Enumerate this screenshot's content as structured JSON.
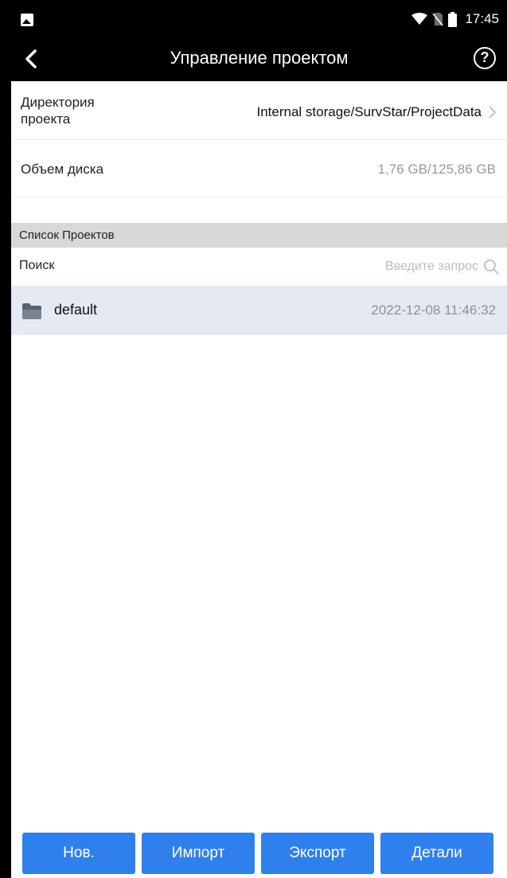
{
  "status_bar": {
    "time": "17:45",
    "icons": [
      "image-icon",
      "wifi-icon",
      "no-sim-icon",
      "battery-icon"
    ]
  },
  "app_bar": {
    "title": "Управление проектом",
    "back_icon": "chevron-left-icon",
    "help_icon": "help-circle-icon",
    "help_glyph": "?"
  },
  "project_directory": {
    "label": "Директория проекта",
    "value": "Internal storage/SurvStar/ProjectData"
  },
  "disk_space": {
    "label": "Объем диска",
    "value": "1,76 GB/125,86 GB"
  },
  "project_list": {
    "header": "Список Проектов",
    "search_label": "Поиск",
    "search_placeholder": "Введите запрос",
    "search_value": "",
    "items": [
      {
        "name": "default",
        "date": "2022-12-08 11:46:32",
        "icon": "folder-icon",
        "selected": true
      }
    ]
  },
  "bottom_buttons": {
    "new_label": "Нов.",
    "import_label": "Импорт",
    "export_label": "Экспорт",
    "details_label": "Детали"
  },
  "colors": {
    "accent": "#2f80ec",
    "selected_row": "#e4e9f3",
    "section_header": "#d8d8d8",
    "bar": "#000000"
  }
}
